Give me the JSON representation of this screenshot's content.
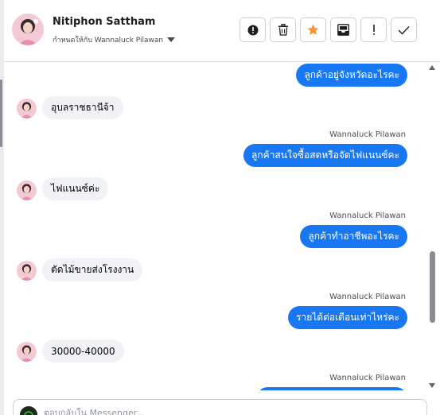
{
  "header": {
    "contact_name": "Nitiphon Sattham",
    "assigned_text": "กำหนดให้กับ Wannaluck Pilawan"
  },
  "toolbar": {
    "buttons": [
      {
        "icon": "alert-circle-icon"
      },
      {
        "icon": "trash-icon"
      },
      {
        "icon": "star-icon"
      },
      {
        "icon": "mail-icon"
      },
      {
        "icon": "exclamation-icon"
      },
      {
        "icon": "check-icon"
      }
    ]
  },
  "thread": {
    "messages": [
      {
        "direction": "out",
        "sender": "",
        "text": "ลูกค้าอยู่จังหวัดอะไรคะ"
      },
      {
        "direction": "in",
        "text": "อุบลราชธานีจ้า"
      },
      {
        "direction": "out",
        "sender": "Wannaluck Pilawan",
        "text": "ลูกค้าสนใจซื้อสดหรือจัดไฟแนนซ์คะ"
      },
      {
        "direction": "in",
        "text": "ไฟแนนซ์ค่ะ"
      },
      {
        "direction": "out",
        "sender": "Wannaluck Pilawan",
        "text": "ลูกค้าทำอาชีพอะไรคะ"
      },
      {
        "direction": "in",
        "text": "ตัดไม้ขายส่งโรงงาน"
      },
      {
        "direction": "out",
        "sender": "Wannaluck Pilawan",
        "text": "รายได้ต่อเดือนเท่าไหร่คะ"
      },
      {
        "direction": "in",
        "text": "30000-40000"
      },
      {
        "direction": "out",
        "sender": "Wannaluck Pilawan",
        "text": ""
      }
    ]
  },
  "composer": {
    "placeholder": "ตอบกลับใน Messenger..."
  },
  "colors": {
    "outgoing_bubble": "#1877f2",
    "incoming_bubble": "#f0f2f5",
    "star": "#f7923a"
  }
}
